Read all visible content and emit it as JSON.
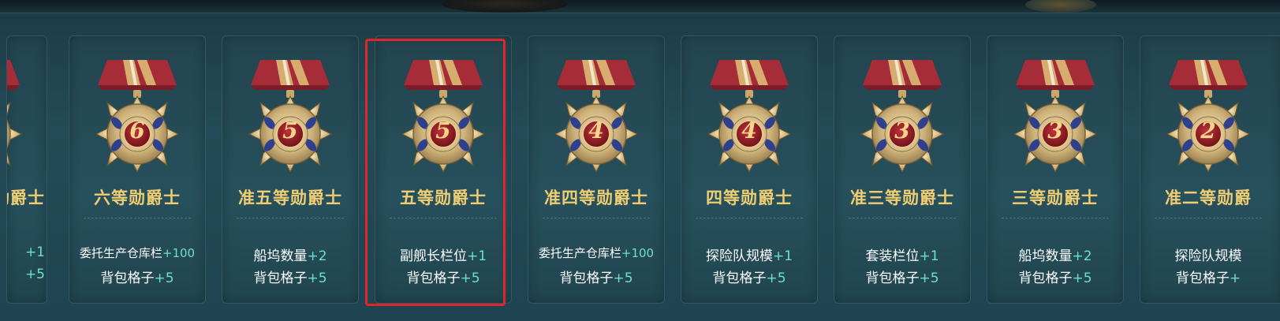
{
  "cards": [
    {
      "rank": "等勋爵士",
      "medal_number": "",
      "line1_label": "",
      "line1_bonus": "+1",
      "line2_label": "",
      "line2_bonus": "+5"
    },
    {
      "rank": "六等勋爵士",
      "medal_number": "6",
      "line1_label": "委托生产仓库栏",
      "line1_bonus": "+100",
      "line2_label": "背包格子",
      "line2_bonus": "+5"
    },
    {
      "rank": "准五等勋爵士",
      "medal_number": "5",
      "line1_label": "船坞数量",
      "line1_bonus": "+2",
      "line2_label": "背包格子",
      "line2_bonus": "+5"
    },
    {
      "rank": "五等勋爵士",
      "medal_number": "5",
      "line1_label": "副舰长栏位",
      "line1_bonus": "+1",
      "line2_label": "背包格子",
      "line2_bonus": "+5"
    },
    {
      "rank": "准四等勋爵士",
      "medal_number": "4",
      "line1_label": "委托生产仓库栏",
      "line1_bonus": "+100",
      "line2_label": "背包格子",
      "line2_bonus": "+5"
    },
    {
      "rank": "四等勋爵士",
      "medal_number": "4",
      "line1_label": "探险队规模",
      "line1_bonus": "+1",
      "line2_label": "背包格子",
      "line2_bonus": "+5"
    },
    {
      "rank": "准三等勋爵士",
      "medal_number": "3",
      "line1_label": "套装栏位",
      "line1_bonus": "+1",
      "line2_label": "背包格子",
      "line2_bonus": "+5"
    },
    {
      "rank": "三等勋爵士",
      "medal_number": "3",
      "line1_label": "船坞数量",
      "line1_bonus": "+2",
      "line2_label": "背包格子",
      "line2_bonus": "+5"
    },
    {
      "rank": "准二等勋爵",
      "medal_number": "2",
      "line1_label": "探险队规模",
      "line1_bonus": "",
      "line2_label": "背包格子",
      "line2_bonus": "+"
    }
  ],
  "selected_index": 3,
  "colors": {
    "rank_text": "#f0cc72",
    "bonus_text": "#6fe0c8",
    "selection": "#e0252b",
    "ribbon_red": "#a62c37",
    "ribbon_gold": "#d6ad6e"
  },
  "icons": {
    "medal": "knight-medal-icon"
  }
}
